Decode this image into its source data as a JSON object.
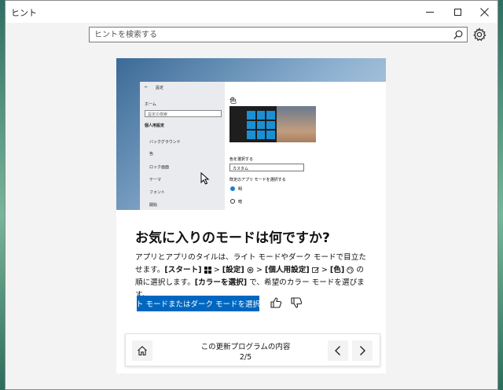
{
  "window": {
    "title": "ヒント"
  },
  "search": {
    "placeholder": "ヒントを検索する"
  },
  "hero": {
    "settings_window_title": "設定",
    "back": "←",
    "home": "ホーム",
    "search_placeholder": "設定の検索",
    "section": "個人用設定",
    "nav": [
      "バックグラウンド",
      "色",
      "ロック画面",
      "テーマ",
      "フォント",
      "開始"
    ],
    "heading": "色",
    "choose_color_label": "色を選択する",
    "choose_color_value": "カスタム",
    "default_app_mode_label": "既定のアプリ モードを選択する",
    "radio_light": "明",
    "radio_dark": "暗"
  },
  "tip": {
    "title": "お気に入りのモードは何ですか?",
    "body_1": "アプリとアプリのタイルは、ライト モードやダーク モードで目立たせます。",
    "start": "[スタート]",
    "sep": " > ",
    "settings": "[設定]",
    "personalization": "[個人用設定]",
    "colors": "[色]",
    "body_2": " の順に選択します。",
    "choose_color": "[カラーを選択]",
    "body_3": " で、希望のカラー モードを選びます。",
    "button": "ライト モードまたはダーク モードを選択する"
  },
  "footer": {
    "label": "この更新プログラムの内容",
    "page": "2/5"
  },
  "colors": {
    "accent": "#0067c0",
    "background": "#f3f3f3"
  }
}
